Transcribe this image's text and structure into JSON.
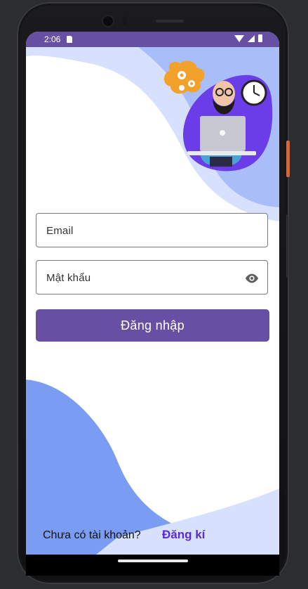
{
  "status_bar": {
    "time": "2:06",
    "icons": [
      "sd-card-icon",
      "wifi-icon",
      "signal-icon",
      "battery-icon"
    ]
  },
  "illustration": {
    "subject": "man with laptop, gears and clock",
    "icons": [
      "gears-icon",
      "clock-icon",
      "laptop-icon"
    ]
  },
  "form": {
    "email_label": "Email",
    "password_label": "Mật khẩu",
    "password_toggle_icon": "eye-icon",
    "login_button": "Đăng nhập"
  },
  "footer": {
    "no_account_text": "Chưa có tài khoản?",
    "register_link": "Đăng kí"
  },
  "colors": {
    "primary": "#6750a4",
    "wave_light": "#d7e0fd",
    "wave_mid": "#a9bdf9",
    "wave_dark": "#7a9df3",
    "link": "#5b2ad6",
    "illustration_purple": "#6a3de8"
  }
}
